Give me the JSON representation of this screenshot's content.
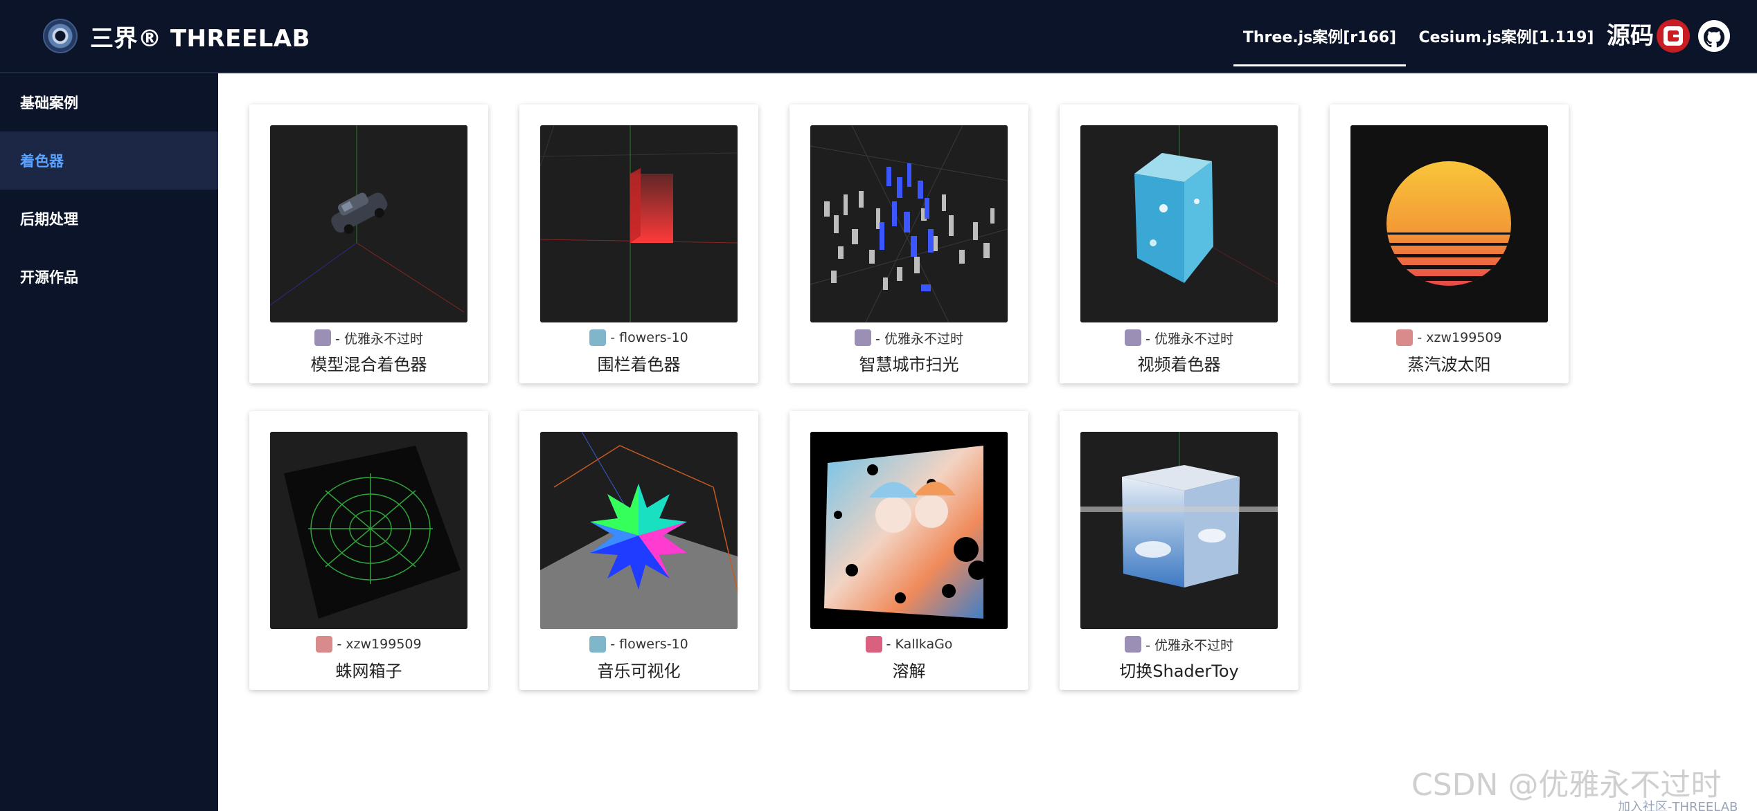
{
  "header": {
    "brand": "三界® THREELAB",
    "tabs": [
      {
        "label": "Three.js案例[r166]",
        "active": true
      },
      {
        "label": "Cesium.js案例[1.119]",
        "active": false
      }
    ],
    "source_label": "源码",
    "icons": [
      "threelab-logo-icon",
      "gitee-icon",
      "github-icon"
    ]
  },
  "sidebar": {
    "items": [
      {
        "label": "基础案例",
        "active": false
      },
      {
        "label": "着色器",
        "active": true
      },
      {
        "label": "后期处理",
        "active": false
      },
      {
        "label": "开源作品",
        "active": false
      }
    ]
  },
  "cards": [
    {
      "author": "- 优雅永不过时",
      "title": "模型混合着色器",
      "avatar_color": "#9b8fb5"
    },
    {
      "author": "- flowers-10",
      "title": "围栏着色器",
      "avatar_color": "#7fb6c9"
    },
    {
      "author": "- 优雅永不过时",
      "title": "智慧城市扫光",
      "avatar_color": "#9b8fb5"
    },
    {
      "author": "- 优雅永不过时",
      "title": "视频着色器",
      "avatar_color": "#9b8fb5"
    },
    {
      "author": "- xzw199509",
      "title": "蒸汽波太阳",
      "avatar_color": "#d98b8b"
    },
    {
      "author": "- xzw199509",
      "title": "蛛网箱子",
      "avatar_color": "#d98b8b"
    },
    {
      "author": "- flowers-10",
      "title": "音乐可视化",
      "avatar_color": "#7fb6c9"
    },
    {
      "author": "- KallkaGo",
      "title": "溶解",
      "avatar_color": "#d9607f"
    },
    {
      "author": "- 优雅永不过时",
      "title": "切换ShaderToy",
      "avatar_color": "#9b8fb5"
    }
  ],
  "watermark": {
    "text": "CSDN @优雅永不过时",
    "sub": "加入社区-THREELAB"
  },
  "colors": {
    "header_bg": "#0b1428",
    "sidebar_active_bg": "#1b2744",
    "sidebar_active_text": "#5aa2ff"
  }
}
